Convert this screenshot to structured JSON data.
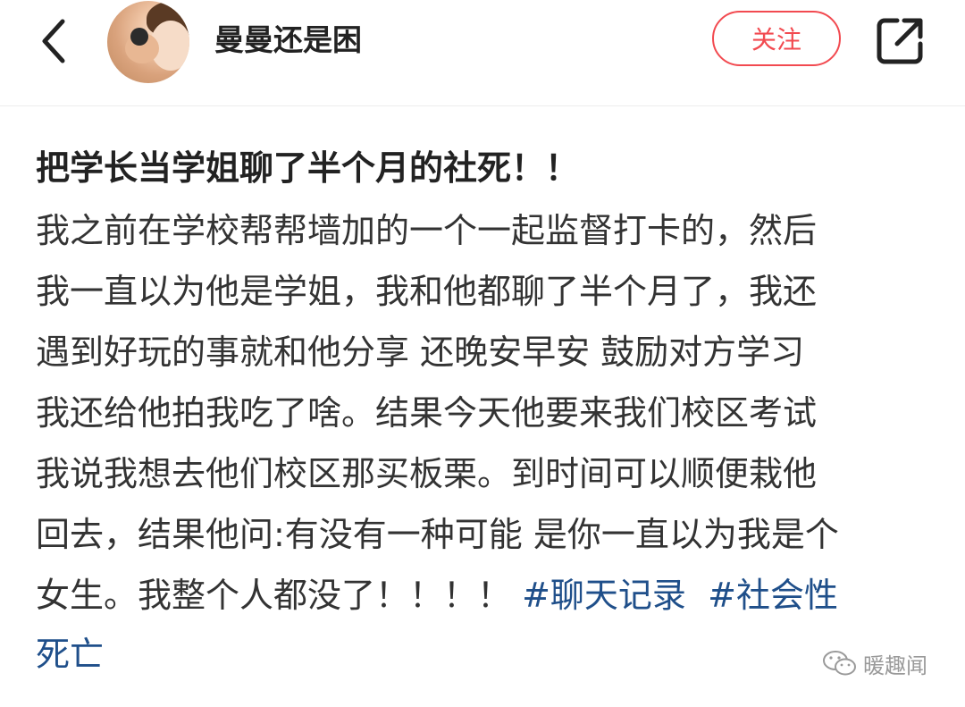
{
  "header": {
    "back_icon": "chevron-left-icon",
    "username": "曼曼还是困",
    "follow_label": "关注",
    "share_icon": "share-external-icon",
    "follow_color": "#f24a50"
  },
  "post": {
    "title": "把学长当学姐聊了半个月的社死！！",
    "lines": [
      "我之前在学校帮帮墙加的一个一起监督打卡的，然后",
      "我一直以为他是学姐，我和他都聊了半个月了，我还",
      "遇到好玩的事就和他分享 还晚安早安 鼓励对方学习",
      "我还给他拍我吃了啥。结果今天他要来我们校区考试",
      "我说我想去他们校区那买板栗。到时间可以顺便栽他",
      "回去，结果他问:有没有一种可能 是你一直以为我是个",
      "女生。我整个人都没了！！！！ "
    ],
    "hashtag_1": "#聊天记录",
    "hashtag_2_part1": "#社会性",
    "hashtag_2_part2": "死亡",
    "hashtag_color": "#1f4f8a"
  },
  "watermark": {
    "icon": "wechat-icon",
    "text": "暖趣闻"
  }
}
